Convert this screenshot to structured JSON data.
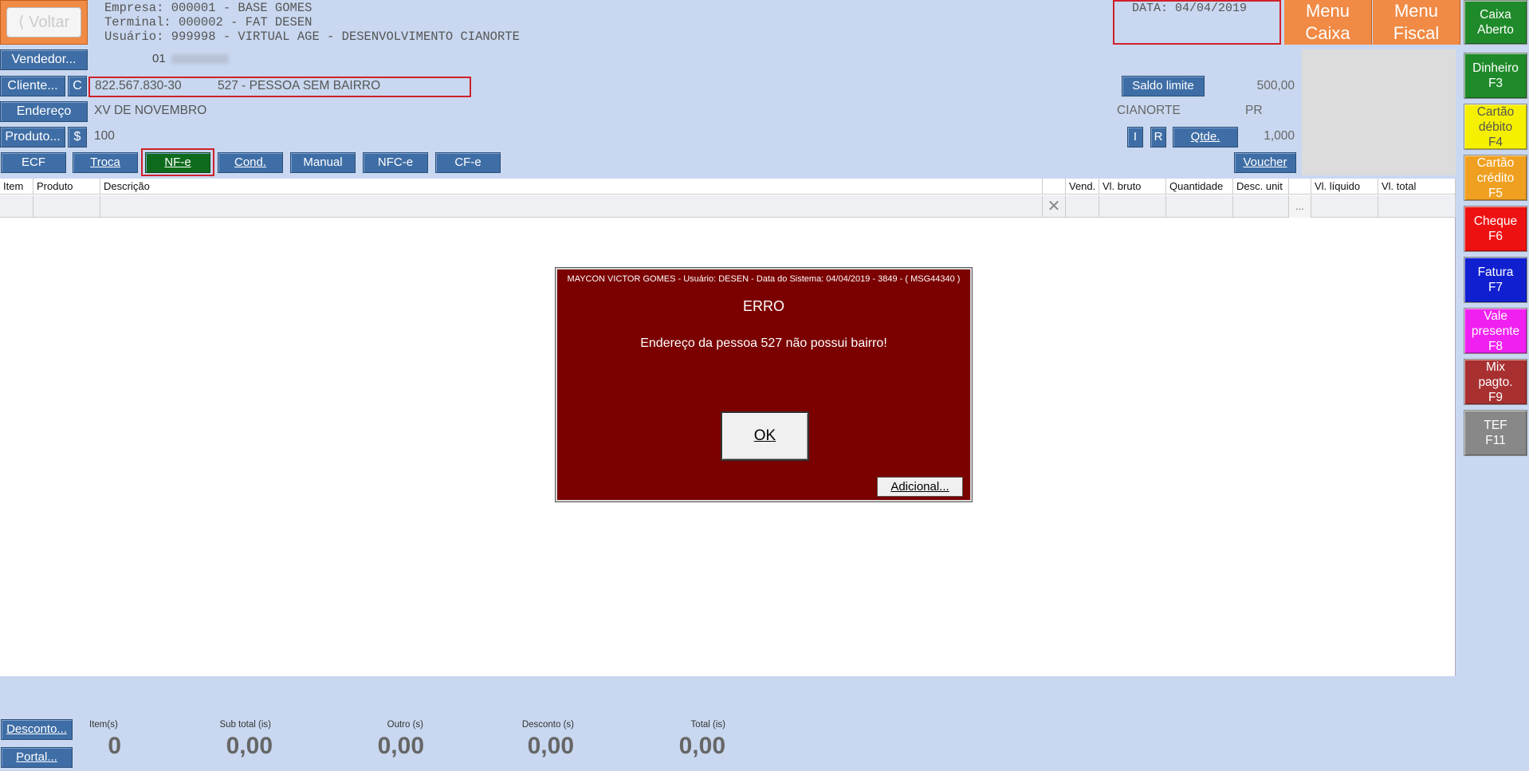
{
  "header": {
    "back_label": "Voltar",
    "empresa": "Empresa: 000001 - BASE GOMES",
    "terminal": "Terminal: 000002 - FAT DESEN",
    "usuario": "Usuário: 999998 - VIRTUAL AGE - DESENVOLVIMENTO CIANORTE",
    "data": "DATA: 04/04/2019",
    "menu_caixa": [
      "Menu",
      "Caixa"
    ],
    "menu_fiscal": [
      "Menu",
      "Fiscal"
    ]
  },
  "form": {
    "vendedor_label": "Vendedor...",
    "vendedor_code": "01",
    "cliente_label": "Cliente...",
    "cliente_c": "C",
    "cliente_doc": "822.567.830-30",
    "cliente_name": "527 - PESSOA SEM BAIRRO",
    "endereco_label": "Endereço",
    "endereco_value": "XV DE NOVEMBRO",
    "produto_label": "Produto...",
    "produto_dollar": "$",
    "produto_value": "100",
    "saldo_label": "Saldo limite",
    "saldo_value": "500,00",
    "cidade": "CIANORTE",
    "uf": "PR",
    "btn_i": "I",
    "btn_r": "R",
    "qtde_label": "Qtde.",
    "qtde_value": "1,000",
    "voucher_label": "Voucher"
  },
  "doc_buttons": [
    "ECF",
    "Troca",
    "NF-e",
    "Cond.",
    "Manual",
    "NFC-e",
    "CF-e"
  ],
  "grid": {
    "columns": [
      "Item",
      "Produto",
      "Descrição",
      "Vend.",
      "Vl. bruto",
      "Quantidade",
      "Desc. unit",
      "Vl. líquido",
      "Vl. total"
    ],
    "ellipsis": "..."
  },
  "sidebar": [
    {
      "label": [
        "Caixa",
        "Aberto"
      ],
      "bg": "#1f8a2a",
      "fg": "#ffffff"
    },
    {
      "label": [
        "Dinheiro",
        "F3"
      ],
      "bg": "#1f8a2a",
      "fg": "#ffffff"
    },
    {
      "label": [
        "Cartão",
        "débito",
        "F4"
      ],
      "bg": "#f5f000",
      "fg": "#555555"
    },
    {
      "label": [
        "Cartão",
        "crédito",
        "F5"
      ],
      "bg": "#f0a020",
      "fg": "#ffffff"
    },
    {
      "label": [
        "Cheque",
        "F6"
      ],
      "bg": "#ee1111",
      "fg": "#ffffff"
    },
    {
      "label": [
        "Fatura",
        "F7"
      ],
      "bg": "#1020d0",
      "fg": "#ffffff"
    },
    {
      "label": [
        "Vale",
        "presente",
        "F8"
      ],
      "bg": "#f020f0",
      "fg": "#ffffff"
    },
    {
      "label": [
        "Mix",
        "pagto.",
        "F9"
      ],
      "bg": "#a83030",
      "fg": "#ffffff"
    },
    {
      "label": [
        "TEF",
        "F11"
      ],
      "bg": "#888888",
      "fg": "#ffffff"
    }
  ],
  "dialog": {
    "title": "MAYCON VICTOR GOMES - Usuário: DESEN - Data do Sistema: 04/04/2019 - 3849 - ( MSG44340 )",
    "heading": "ERRO",
    "message": "Endereço da pessoa 527 não possui bairro!",
    "ok": "OK",
    "adicional": "Adicional..."
  },
  "footer": {
    "desconto_label": "Desconto...",
    "portal_label": "Portal...",
    "items_label": "Item(s)",
    "items_value": "0",
    "subtotal_label": "Sub total (is)",
    "subtotal_value": "0,00",
    "outro_label": "Outro (s)",
    "outro_value": "0,00",
    "desconto_s_label": "Desconto (s)",
    "desconto_s_value": "0,00",
    "total_label": "Total (is)",
    "total_value": "0,00"
  }
}
